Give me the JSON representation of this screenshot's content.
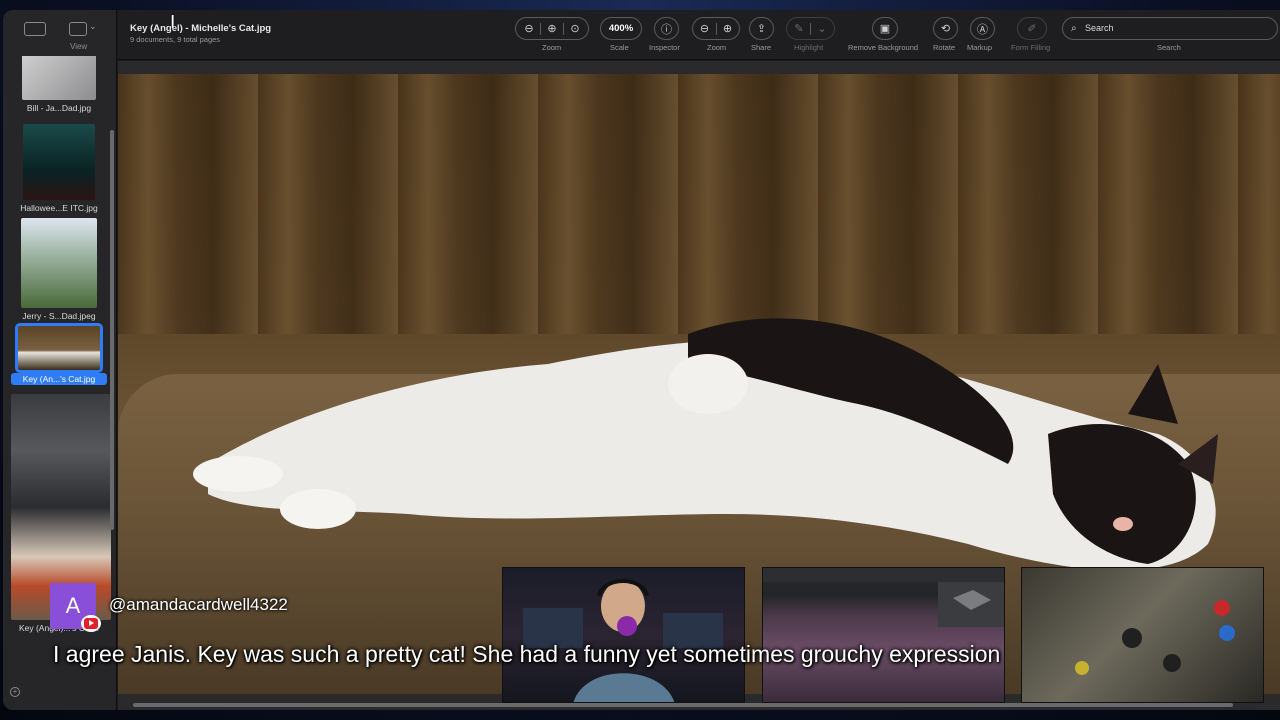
{
  "sidebar": {
    "view_label": "View",
    "thumbnails": [
      {
        "caption": "Bill - Ja...Dad.jpg",
        "selected": false
      },
      {
        "caption": "Hallowee...E ITC.jpg",
        "selected": false
      },
      {
        "caption": "Jerry - S...Dad.jpeg",
        "selected": false
      },
      {
        "caption": "Key (An...'s Cat.jpg",
        "selected": true
      },
      {
        "caption": "Key (Angel)...'s Cat...",
        "selected": false
      }
    ]
  },
  "toolbar": {
    "title": "Key (Angel) - Michelle's Cat.jpg",
    "subtitle": "9 documents, 9 total pages",
    "zoom_label": "Zoom",
    "scale_value": "400%",
    "scale_label": "Scale",
    "inspector_label": "Inspector",
    "zoom2_label": "Zoom",
    "share_label": "Share",
    "highlight_label": "Highlight",
    "remove_bg_label": "Remove Background",
    "rotate_label": "Rotate",
    "markup_label": "Markup",
    "form_filling_label": "Form Filling",
    "search_placeholder": "Search",
    "search_label": "Search"
  },
  "stream": {
    "avatar_letter": "A",
    "username": "@amandacardwell4322",
    "message": "I agree Janis. Key was such a pretty cat! She had a funny yet sometimes grouchy expression"
  },
  "colors": {
    "accent": "#2f7cf6",
    "avatar": "#8a4fd8",
    "youtube": "#e0202a"
  }
}
